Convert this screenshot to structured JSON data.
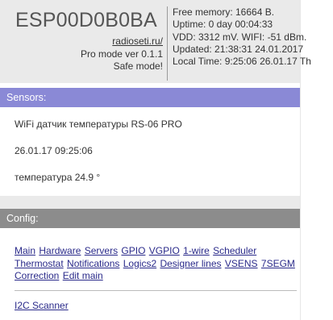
{
  "header": {
    "device_name": "ESP00D0B0BA",
    "site_link": "radioseti.ru/",
    "mode_version": "Pro mode ver 0.1.1",
    "safe_mode": "Safe mode!",
    "status_lines": [
      "Free memory: 16664 B.",
      "Uptime: 0 day 00:04:33",
      "VDD: 3312 mV. WIFI: -51 dBm.",
      "Updated: 21:38:31 24.01.2017",
      "Local Time: 9:25:06 26.01.17 Th"
    ]
  },
  "sensors": {
    "title": "Sensors:",
    "lines": [
      "WiFi датчик температуры RS-06 PRO",
      "26.01.17 09:25:06",
      "температура 24.9 °"
    ]
  },
  "config": {
    "title": "Config:",
    "links": [
      "Main",
      "Hardware",
      "Servers",
      "GPIO",
      "VGPIO",
      "1-wire",
      "Scheduler",
      "Thermostat",
      "Notifications",
      "Logics2",
      "Designer lines",
      "VSENS",
      "7SEGM",
      "Correction",
      "Edit main"
    ],
    "scanner_link": "I2C Scanner"
  },
  "colors": {
    "sensors_bar": "#8a89d6",
    "config_bar": "#8c8c8c",
    "header_bg": "#eaeaea"
  }
}
